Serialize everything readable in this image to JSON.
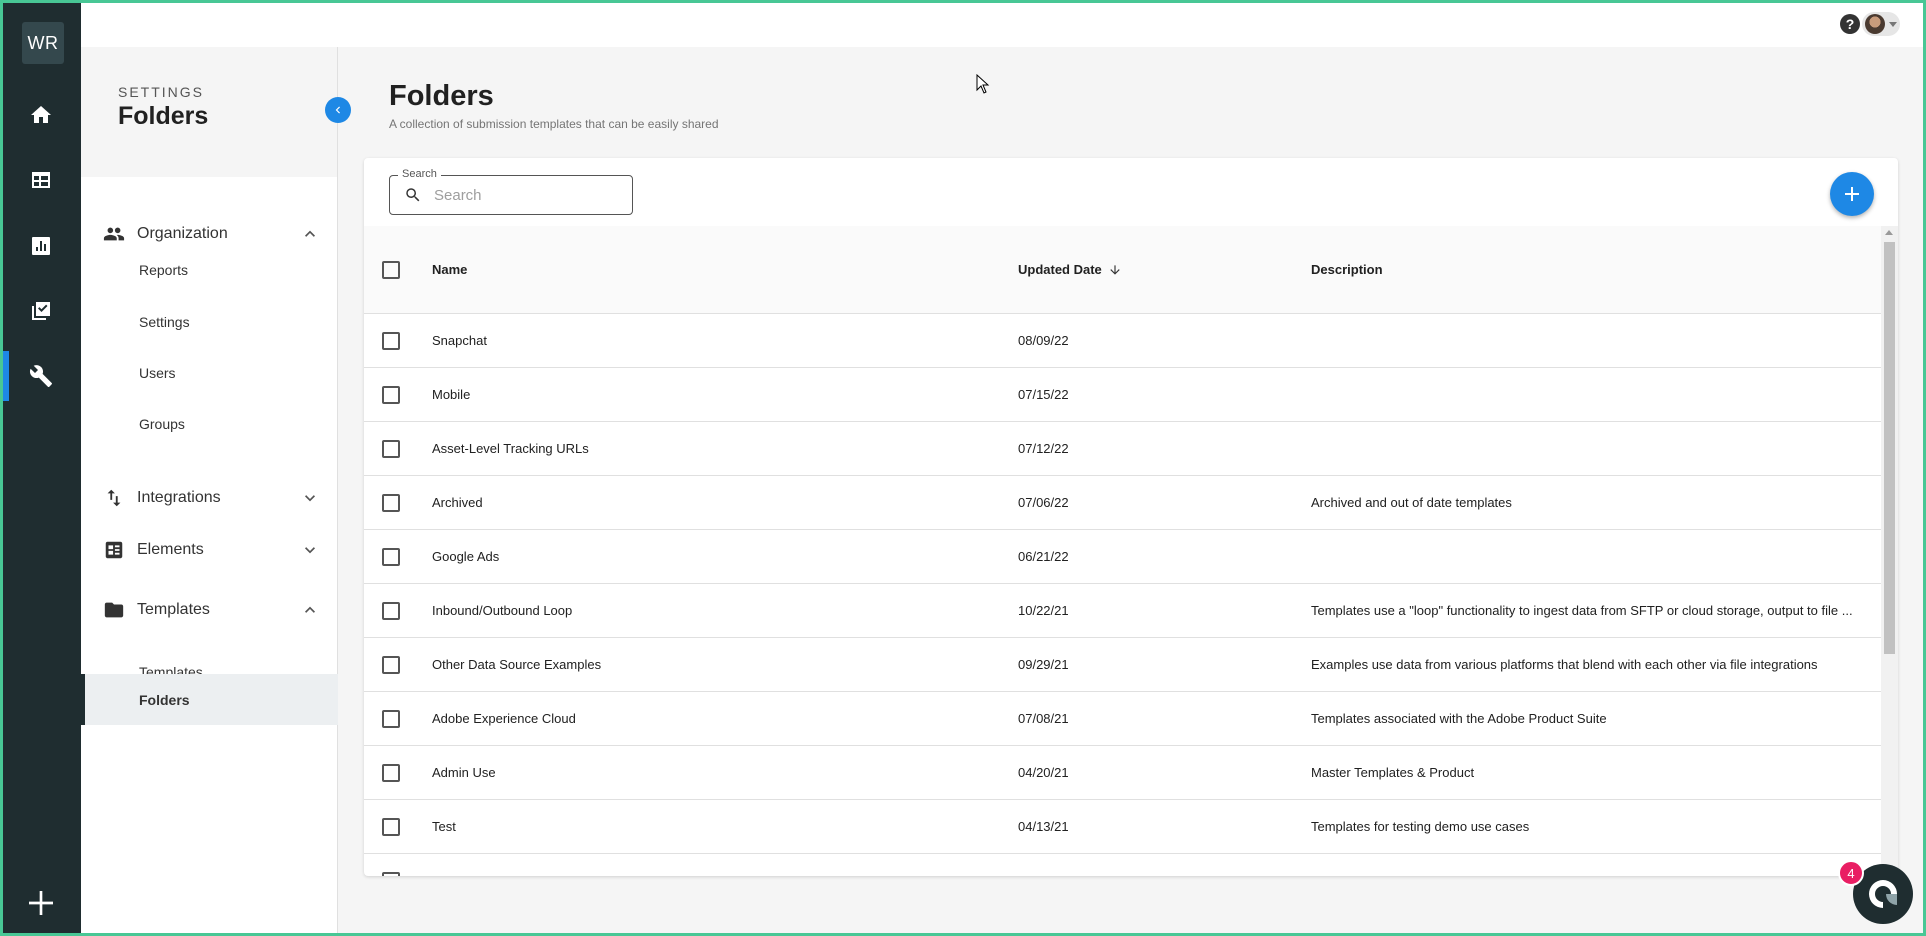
{
  "rail": {
    "logo": "WR",
    "items": [
      "home-icon",
      "table-icon",
      "chart-icon",
      "checklist-icon",
      "wrench-icon"
    ],
    "active": "wrench-icon"
  },
  "topbar": {
    "help": "?"
  },
  "sidebar": {
    "eyebrow": "SETTINGS",
    "title": "Folders",
    "groups": [
      {
        "label": "Organization",
        "icon": "people-icon",
        "expanded": true,
        "items": [
          "Reports",
          "Settings",
          "Users",
          "Groups"
        ]
      },
      {
        "label": "Integrations",
        "icon": "swap-icon",
        "expanded": false
      },
      {
        "label": "Elements",
        "icon": "elements-icon",
        "expanded": false
      },
      {
        "label": "Templates",
        "icon": "folder-icon",
        "expanded": true,
        "items": [
          "Templates",
          "Folders"
        ]
      }
    ],
    "active_item": "Folders"
  },
  "main": {
    "title": "Folders",
    "subtitle": "A collection of submission templates that can be easily shared",
    "search": {
      "legend": "Search",
      "placeholder": "Search",
      "value": ""
    },
    "table": {
      "columns": [
        "Name",
        "Updated Date",
        "Description"
      ],
      "sort": {
        "column": "Updated Date",
        "direction": "desc"
      },
      "rows": [
        {
          "name": "Snapchat",
          "date": "08/09/22",
          "desc": ""
        },
        {
          "name": "Mobile",
          "date": "07/15/22",
          "desc": ""
        },
        {
          "name": "Asset-Level Tracking URLs",
          "date": "07/12/22",
          "desc": ""
        },
        {
          "name": "Archived",
          "date": "07/06/22",
          "desc": "Archived and out of date templates"
        },
        {
          "name": "Google Ads",
          "date": "06/21/22",
          "desc": ""
        },
        {
          "name": "Inbound/Outbound Loop",
          "date": "10/22/21",
          "desc": "Templates use a \"loop\" functionality to ingest data from SFTP or cloud storage, output to file ..."
        },
        {
          "name": "Other Data Source Examples",
          "date": "09/29/21",
          "desc": "Examples use data from various platforms that blend with each other via file integrations"
        },
        {
          "name": "Adobe Experience Cloud",
          "date": "07/08/21",
          "desc": "Templates associated with the Adobe Product Suite"
        },
        {
          "name": "Admin Use",
          "date": "04/20/21",
          "desc": "Master Templates & Product"
        },
        {
          "name": "Test",
          "date": "04/13/21",
          "desc": "Templates for testing demo use cases"
        },
        {
          "name": "",
          "date": "",
          "desc": ""
        }
      ]
    }
  },
  "chat": {
    "badge": "4"
  },
  "colors": {
    "accent": "#1e88e5",
    "rail": "#1f2d30",
    "badge": "#e91e63",
    "frame": "#48c795"
  }
}
